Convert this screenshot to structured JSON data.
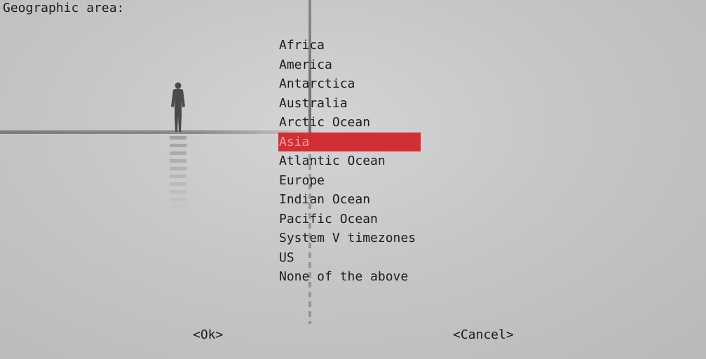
{
  "dialog": {
    "title": "Geographic area:",
    "selected_index": 5,
    "items": [
      {
        "label": "Africa"
      },
      {
        "label": "America"
      },
      {
        "label": "Antarctica"
      },
      {
        "label": "Australia"
      },
      {
        "label": "Arctic Ocean"
      },
      {
        "label": "Asia"
      },
      {
        "label": "Atlantic Ocean"
      },
      {
        "label": "Europe"
      },
      {
        "label": "Indian Ocean"
      },
      {
        "label": "Pacific Ocean"
      },
      {
        "label": "System V timezones"
      },
      {
        "label": "US"
      },
      {
        "label": "None of the above"
      }
    ],
    "ok_label": "<Ok>",
    "cancel_label": "<Cancel>"
  },
  "colors": {
    "selection_background": "#d22f34",
    "selection_text": "#ff9aa2",
    "text": "#1c1c1c"
  }
}
